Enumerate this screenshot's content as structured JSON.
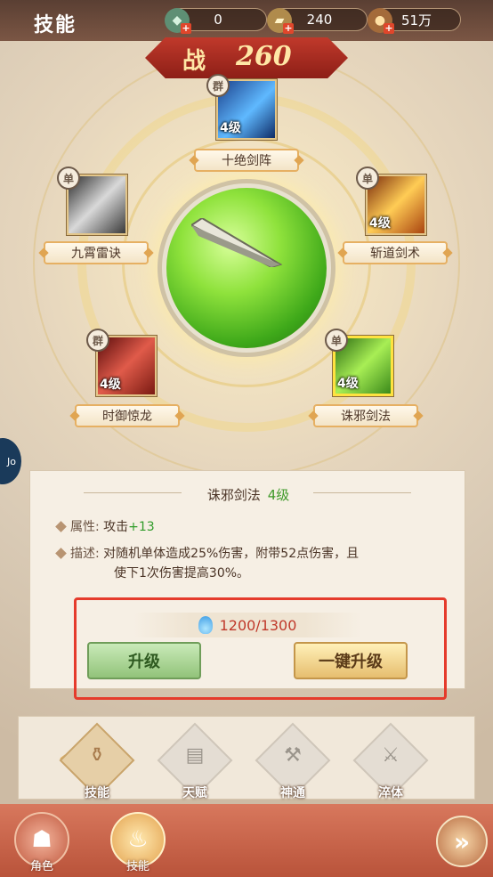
{
  "header": {
    "title": "技能",
    "resources": [
      {
        "icon": "jade-icon",
        "value": "0"
      },
      {
        "icon": "ingot-icon",
        "value": "240"
      },
      {
        "icon": "coin-icon",
        "value": "51万"
      }
    ]
  },
  "power": {
    "label": "战",
    "value": "260"
  },
  "skills": [
    {
      "name": "十绝剑阵",
      "level": "4级",
      "tag": "群"
    },
    {
      "name": "九霄雷诀",
      "level": "",
      "tag": "单"
    },
    {
      "name": "斩道剑术",
      "level": "4级",
      "tag": ""
    },
    {
      "name": "时御惊龙",
      "level": "4级",
      "tag": "群"
    },
    {
      "name": "诛邪剑法",
      "level": "4级",
      "tag": "单"
    }
  ],
  "colors": {
    "accent_red": "#e53b2c",
    "green": "#2f9b29",
    "gold": "#e6b063"
  },
  "detail": {
    "title": "诛邪剑法",
    "level": "4级",
    "attr_label": "属性:",
    "attr_text": "攻击",
    "attr_bonus": "+13",
    "desc_label": "描述:",
    "desc_line1": "对随机单体造成25%伤害，附带52点伤害，且",
    "desc_line2": "使下1次伤害提高30%。"
  },
  "upgrade": {
    "cost": "1200/1300",
    "btn_upgrade": "升级",
    "btn_one_key": "一键升级"
  },
  "tabs": [
    {
      "label": "技能",
      "icon": "skill-icon",
      "active": true
    },
    {
      "label": "天赋",
      "icon": "book-icon",
      "active": false
    },
    {
      "label": "神通",
      "icon": "hammer-icon",
      "active": false
    },
    {
      "label": "淬体",
      "icon": "sword-icon",
      "active": false
    }
  ],
  "bottom_nav": [
    {
      "label": "角色",
      "icon": "character-icon"
    },
    {
      "label": "技能",
      "icon": "skill-icon"
    }
  ],
  "side_badge": "Jo\nAY"
}
